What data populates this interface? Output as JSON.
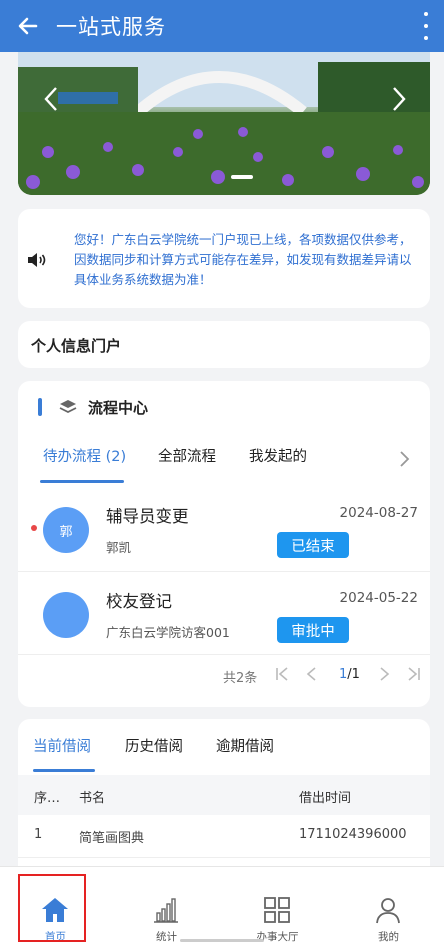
{
  "header": {
    "title": "一站式服务",
    "back_icon": "back-arrow-icon",
    "more_icon": "more-vertical-icon"
  },
  "banner": {
    "prev_icon": "chevron-left-icon",
    "next_icon": "chevron-right-icon"
  },
  "notice": {
    "icon": "speaker-icon",
    "text": "您好！广东白云学院统一门户现已上线，各项数据仅供参考，因数据同步和计算方式可能存在差异，如发现有数据差异请以具体业务系统数据为准！"
  },
  "portal": {
    "title": "个人信息门户"
  },
  "process_center": {
    "title": "流程中心",
    "icon": "layers-icon",
    "tabs": [
      "待办流程 (2)",
      "全部流程",
      "我发起的"
    ],
    "items": [
      {
        "avatar_text": "郭",
        "title": "辅导员变更",
        "date": "2024-08-27",
        "person": "郭凯",
        "status": "已结束",
        "unread": true
      },
      {
        "avatar_text": "",
        "title": "校友登记",
        "date": "2024-05-22",
        "person": "广东白云学院访客001",
        "status": "审批中",
        "unread": false
      }
    ],
    "pager": {
      "total": "共2条",
      "current": "1",
      "pages": "/1"
    }
  },
  "borrow": {
    "tabs": [
      "当前借阅",
      "历史借阅",
      "逾期借阅"
    ],
    "columns": [
      "序…",
      "书名",
      "借出时间"
    ],
    "rows": [
      {
        "index": "1",
        "book": "简笔画图典",
        "time": "1711024396000"
      }
    ]
  },
  "bottom_nav": [
    {
      "label": "首页",
      "icon": "home-icon",
      "active": true
    },
    {
      "label": "统计",
      "icon": "bar-chart-icon",
      "active": false
    },
    {
      "label": "办事大厅",
      "icon": "grid-icon",
      "active": false
    },
    {
      "label": "我的",
      "icon": "user-icon",
      "active": false
    }
  ],
  "colors": {
    "primary": "#3a7dd6",
    "status_button": "#1e96ef",
    "highlight": "#e52222",
    "unread_dot": "#e84747"
  }
}
